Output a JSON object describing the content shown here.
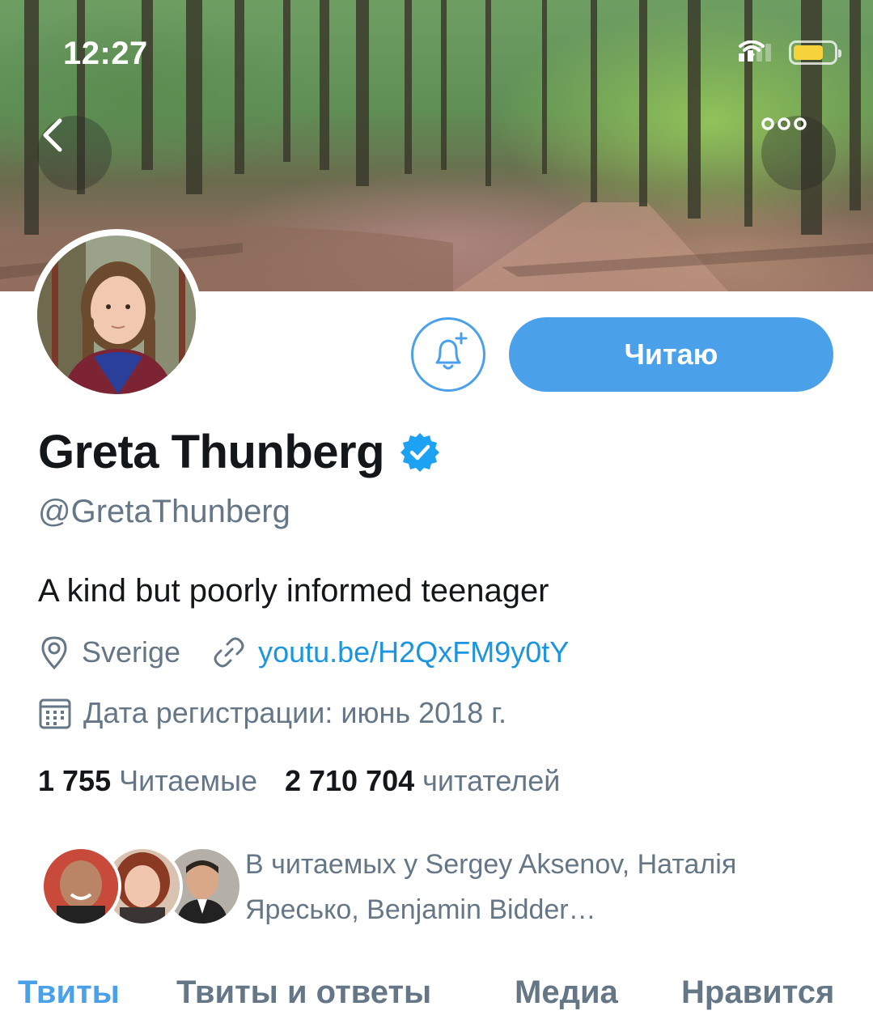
{
  "status_bar": {
    "time": "12:27",
    "battery_level": 0.75,
    "battery_color": "#f6d23c"
  },
  "header": {
    "back_icon": "chevron-left-icon",
    "more_icon": "more-horizontal-icon"
  },
  "profile": {
    "name": "Greta Thunberg",
    "verified": true,
    "verified_color": "#1da1f2",
    "handle": "@GretaThunberg",
    "bio": "A kind but poorly informed teenager",
    "location": "Sverige",
    "link": "youtu.be/H2QxFM9y0tY",
    "joined": "Дата регистрации: июнь 2018 г."
  },
  "actions": {
    "notify_icon": "bell-plus-icon",
    "follow_label": "Читаю",
    "accent_color": "#4ba0ea"
  },
  "stats": {
    "following_count": "1 755",
    "following_label": "Читаемые",
    "followers_count": "2 710 704",
    "followers_label": "читателей"
  },
  "followed_by": {
    "text": "В читаемых у Sergey Aksenov, Наталія Яресько, Benjamin Bidder…"
  },
  "tabs": [
    {
      "label": "Твиты",
      "active": true
    },
    {
      "label": "Твиты и ответы",
      "active": false
    },
    {
      "label": "Медиа",
      "active": false
    },
    {
      "label": "Нравится",
      "active": false
    }
  ]
}
